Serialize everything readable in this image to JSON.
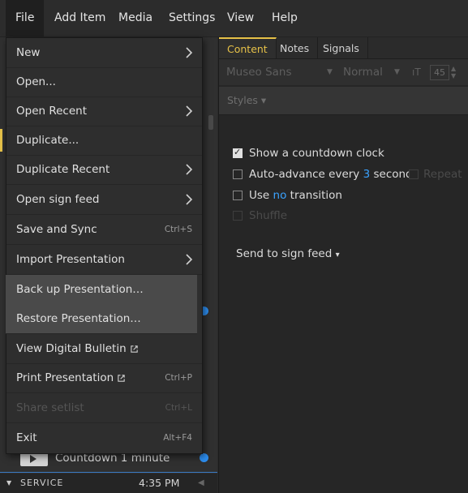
{
  "menubar": {
    "items": [
      "File",
      "Add Item",
      "Media",
      "Settings",
      "View",
      "Help"
    ]
  },
  "file_menu": {
    "items": [
      {
        "label": "New",
        "shortcut": "",
        "submenu": true
      },
      {
        "label": "Open...",
        "shortcut": "",
        "submenu": false
      },
      {
        "label": "Open Recent",
        "shortcut": "",
        "submenu": true
      },
      {
        "label": "Duplicate...",
        "shortcut": "",
        "submenu": false
      },
      {
        "label": "Duplicate Recent",
        "shortcut": "",
        "submenu": true
      },
      {
        "label": "Open sign feed",
        "shortcut": "",
        "submenu": true
      },
      {
        "label": "Save and Sync",
        "shortcut": "Ctrl+S",
        "submenu": false
      },
      {
        "label": "Import Presentation",
        "shortcut": "",
        "submenu": true
      },
      {
        "label": "Back up Presentation…",
        "shortcut": "",
        "submenu": false
      },
      {
        "label": "Restore Presentation…",
        "shortcut": "",
        "submenu": false
      },
      {
        "label": "View Digital Bulletin",
        "shortcut": "",
        "submenu": false
      },
      {
        "label": "Print Presentation",
        "shortcut": "Ctrl+P",
        "submenu": false
      },
      {
        "label": "Share setlist",
        "shortcut": "Ctrl+L",
        "submenu": false
      },
      {
        "label": "Exit",
        "shortcut": "Alt+F4",
        "submenu": false
      }
    ]
  },
  "tabs": [
    "Content",
    "Notes",
    "Signals"
  ],
  "font_toolbar": {
    "font": "Museo Sans",
    "weight": "Normal",
    "size": "45"
  },
  "styles_label": "Styles",
  "options": {
    "countdown": "Show a countdown clock",
    "auto_advance_prefix": "Auto-advance every",
    "auto_advance_value": "3",
    "auto_advance_suffix": "seconds",
    "repeat": "Repeat",
    "use_prefix": "Use",
    "use_value": "no",
    "use_suffix": "transition",
    "shuffle": "Shuffle",
    "send_to_sign_feed": "Send to sign feed"
  },
  "bottom_item": {
    "title": "Countdown 1 minute"
  },
  "footer": {
    "section": "SERVICE",
    "time": "4:35 PM"
  },
  "colors": {
    "accent": "#e6c148",
    "link": "#3aa2ff",
    "selection": "#2d8ef0"
  }
}
